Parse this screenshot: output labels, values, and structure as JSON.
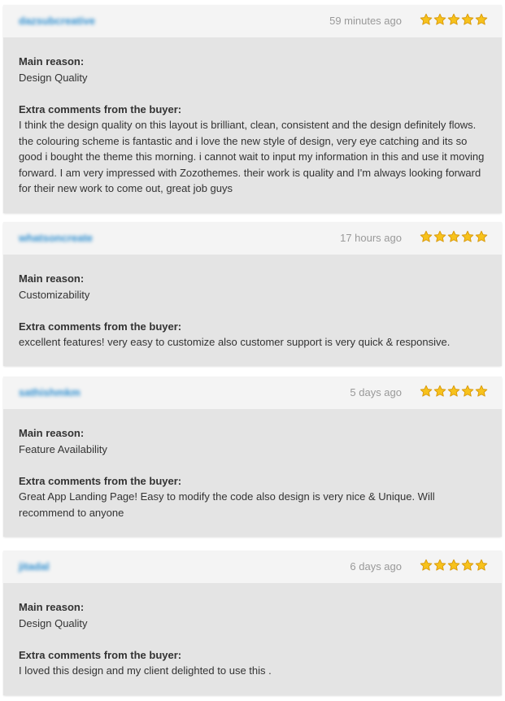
{
  "labels": {
    "main_reason": "Main reason:",
    "extra_comments": "Extra comments from the buyer:"
  },
  "colors": {
    "username": "#2f8fd0",
    "time": "#999999",
    "star_fill": "#f7c21c",
    "header_bg": "#f4f4f4",
    "body_bg": "#e4e4e4"
  },
  "reviews": [
    {
      "username": "dazsubcreative",
      "time": "59 minutes ago",
      "rating": 5,
      "main_reason": "Design Quality",
      "comment": "I think the design quality on this layout is brilliant, clean, consistent and the design definitely flows. the colouring scheme is fantastic and i love the new style of design, very eye catching and its so good i bought the theme this morning. i cannot wait to input my information in this and use it moving forward. I am very impressed with Zozothemes. their work is quality and I'm always looking forward for their new work to come out, great job guys"
    },
    {
      "username": "whatsoncreate",
      "time": "17 hours ago",
      "rating": 5,
      "main_reason": "Customizability",
      "comment": "excellent features! very easy to customize also customer support is very quick & responsive."
    },
    {
      "username": "sathishmkm",
      "time": "5 days ago",
      "rating": 5,
      "main_reason": "Feature Availability",
      "comment": "Great App Landing Page! Easy to modify the code also design is very nice & Unique. Will recommend to anyone"
    },
    {
      "username": "jitadal",
      "time": "6 days ago",
      "rating": 5,
      "main_reason": "Design Quality",
      "comment": "I loved this design and my client delighted to use this ."
    }
  ]
}
